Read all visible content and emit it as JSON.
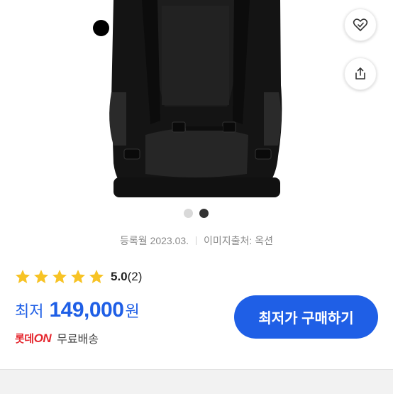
{
  "colors": {
    "accent": "#1f5fe6",
    "star": "#f7c325",
    "lotte_red": "#e5282f"
  },
  "product_image": {
    "alt": "black backpack"
  },
  "carousel": {
    "total": 2,
    "active": 2
  },
  "meta": {
    "registered": "등록월 2023.03.",
    "image_source": "이미지출처: 옥션"
  },
  "rating": {
    "stars": 5,
    "score": "5.0",
    "count": "(2)"
  },
  "price": {
    "label": "최저",
    "amount": "149,000",
    "unit": "원"
  },
  "shipping": {
    "logo_main": "롯데",
    "logo_on": "ON",
    "text": "무료배송"
  },
  "buy_button": {
    "label": "최저가 구매하기"
  },
  "icons": {
    "wish": "heart-check-icon",
    "share": "share-icon"
  }
}
